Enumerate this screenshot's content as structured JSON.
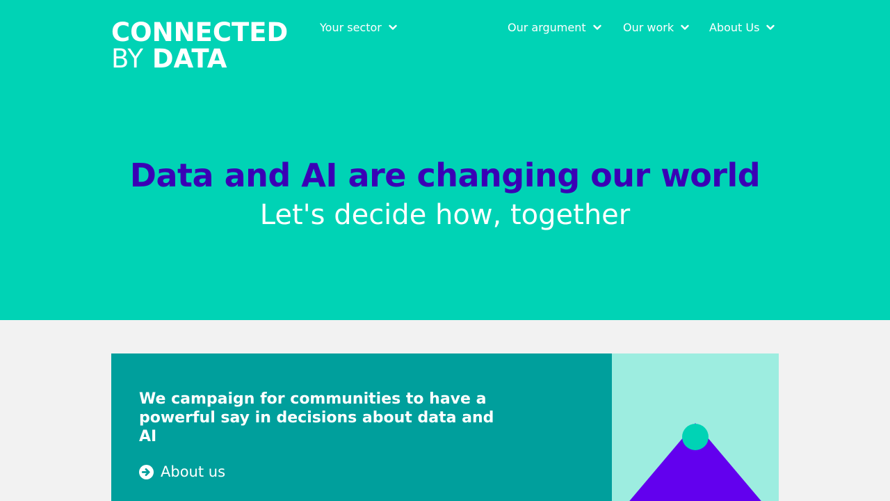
{
  "brand": {
    "line1": "CONNECTED",
    "line2_prefix": "BY",
    "line2_main": "DATA"
  },
  "nav": {
    "items": [
      {
        "label": "Your sector",
        "icon": "chevron-down-icon"
      },
      {
        "label": "Our argument",
        "icon": "chevron-down-icon"
      },
      {
        "label": "Our work",
        "icon": "chevron-down-icon"
      },
      {
        "label": "About Us",
        "icon": "chevron-down-icon"
      }
    ]
  },
  "hero": {
    "headline": "Data and AI are changing our world",
    "subline": "Let's decide how, together"
  },
  "intro_card": {
    "text": "We campaign for communities to have a powerful say in decisions about data and AI",
    "link_label": "About us",
    "link_icon": "arrow-circle-right-icon"
  },
  "colors": {
    "hero_bg": "#00d3b5",
    "headline": "#3a00b5",
    "card_bg": "#009f9c",
    "illus_bg": "#9dede0",
    "triangle": "#6200ee",
    "page_bg": "#f2f2f2"
  }
}
